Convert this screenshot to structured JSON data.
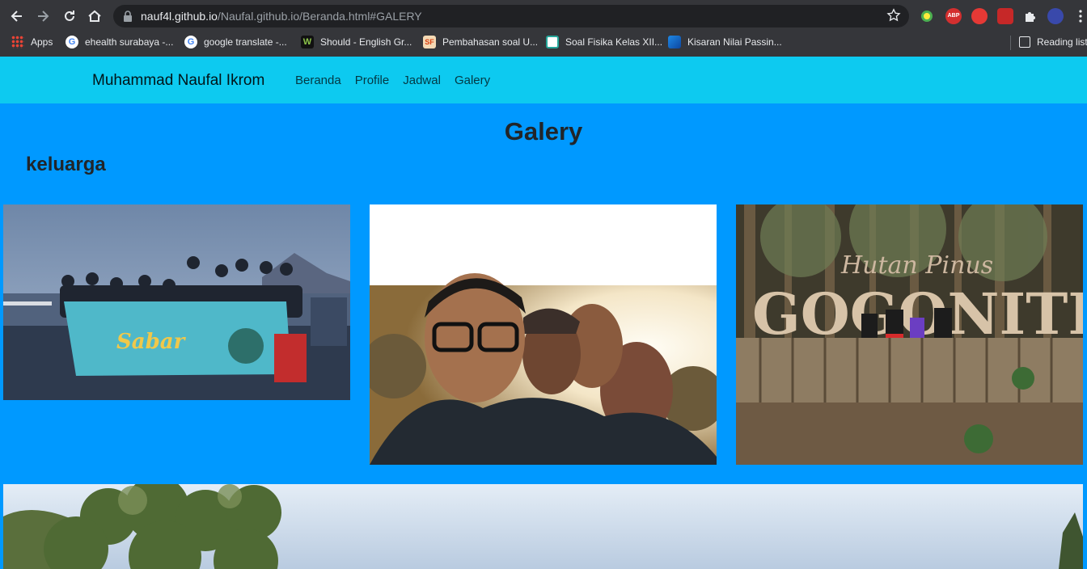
{
  "browser": {
    "url_host": "nauf4l.github.io",
    "url_path": "/Naufal.github.io/Beranda.html#GALERY",
    "bookmarks": [
      {
        "label": "Apps",
        "icon": "apps-grid-icon"
      },
      {
        "label": "ehealth surabaya -...",
        "icon": "google-icon"
      },
      {
        "label": "google translate -...",
        "icon": "google-icon"
      },
      {
        "label": "Should - English Gr...",
        "icon": "w-favicon-icon"
      },
      {
        "label": "Pembahasan soal U...",
        "icon": "sf-favicon-icon"
      },
      {
        "label": "Soal Fisika Kelas XII...",
        "icon": "s-favicon-icon"
      },
      {
        "label": "Kisaran Nilai Passin...",
        "icon": "k-favicon-icon"
      }
    ],
    "reading_list": "Reading list"
  },
  "navbar": {
    "brand": "Muhammad Naufal Ikrom",
    "links": [
      "Beranda",
      "Profile",
      "Jadwal",
      "Galery"
    ]
  },
  "gallery": {
    "title": "Galery",
    "section": "keluarga"
  },
  "colors": {
    "page_bg": "#0099ff",
    "navbar_bg": "#0dcaf0",
    "chrome_bg": "#35363a"
  }
}
